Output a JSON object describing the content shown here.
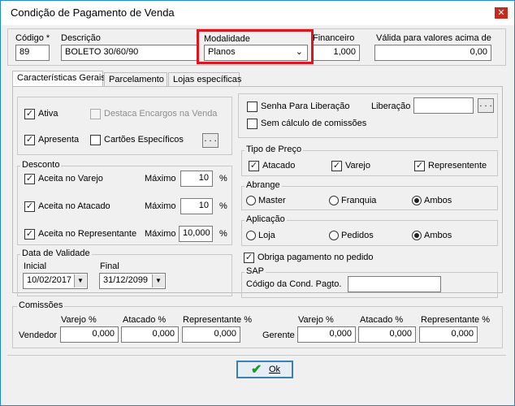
{
  "window": {
    "title": "Condição de Pagamento de Venda",
    "close_glyph": "✕"
  },
  "header": {
    "codigo_label": "Código *",
    "codigo_value": "89",
    "descricao_label": "Descrição",
    "descricao_value": "BOLETO 30/60/90",
    "modalidade_label": "Modalidade",
    "modalidade_value": "Planos",
    "financeiro_label": "Financeiro",
    "financeiro_value": "1,000",
    "valida_label": "Válida para valores acima de",
    "valida_value": "0,00"
  },
  "tabs": [
    {
      "label": "Características Gerais"
    },
    {
      "label": "Parcelamento"
    },
    {
      "label": "Lojas específicas"
    }
  ],
  "general": {
    "ativa": "Ativa",
    "destaca": "Destaca  Encargos na Venda",
    "apresenta": "Apresenta",
    "cartoes": "Cartões Específicos",
    "dots": ". . ."
  },
  "desconto": {
    "title": "Desconto",
    "maximo": "Máximo",
    "pct": "%",
    "rows": [
      {
        "label": "Aceita no Varejo",
        "value": "10"
      },
      {
        "label": "Aceita no Atacado",
        "value": "10"
      },
      {
        "label": "Aceita no Representante",
        "value": "10,000"
      }
    ]
  },
  "validade": {
    "title": "Data de Validade",
    "inicial_label": "Inicial",
    "inicial_value": "10/02/2017",
    "final_label": "Final",
    "final_value": "31/12/2099"
  },
  "senha": {
    "senha_label": "Senha Para Liberação",
    "sem_calculo": "Sem cálculo de comissões",
    "liberacao_label": "Liberação",
    "dots": ". . ."
  },
  "tipo_preco": {
    "title": "Tipo de Preço",
    "items": [
      "Atacado",
      "Varejo",
      "Representente"
    ]
  },
  "abrange": {
    "title": "Abrange",
    "items": [
      "Master",
      "Franquia",
      "Ambos"
    ],
    "selected": "Ambos"
  },
  "aplicacao": {
    "title": "Aplicação",
    "items": [
      "Loja",
      "Pedidos",
      "Ambos"
    ],
    "selected": "Ambos"
  },
  "obriga": "Obriga pagamento no pedido",
  "sap": {
    "title": "SAP",
    "codigo_label": "Código da Cond. Pagto.",
    "codigo_value": ""
  },
  "comissoes": {
    "title": "Comissões",
    "varejo": "Varejo %",
    "atacado": "Atacado %",
    "representante": "Representante %",
    "vendedor_label": "Vendedor",
    "gerente_label": "Gerente",
    "vendedor": [
      "0,000",
      "0,000",
      "0,000"
    ],
    "gerente": [
      "0,000",
      "0,000",
      "0,000"
    ]
  },
  "footer": {
    "ok_label": "Ok"
  },
  "colors": {
    "highlight": "#e0141e",
    "ok_border": "#3c7fb1",
    "check_green": "#1a9b2c"
  }
}
